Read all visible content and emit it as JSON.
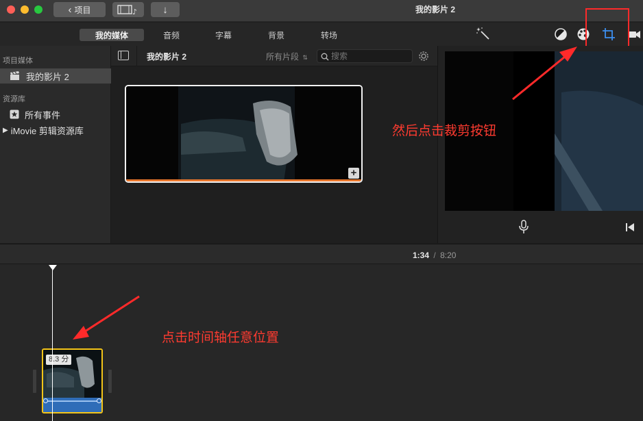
{
  "titlebar": {
    "back_label": "项目",
    "window_title": "我的影片 2"
  },
  "media_tabs": [
    {
      "label": "我的媒体",
      "active": true
    },
    {
      "label": "音频",
      "active": false
    },
    {
      "label": "字幕",
      "active": false
    },
    {
      "label": "背景",
      "active": false
    },
    {
      "label": "转场",
      "active": false
    }
  ],
  "sidebar": {
    "section_project_media": "项目媒体",
    "project_item": "我的影片 2",
    "section_library": "资源库",
    "all_events": "所有事件",
    "library_item": "iMovie 剪辑资源库"
  },
  "browser": {
    "title": "我的影片 2",
    "filter_label": "所有片段",
    "search_placeholder": "搜索"
  },
  "timeline": {
    "current_time": "1:34",
    "separator": "/",
    "total_time": "8:20",
    "clip_duration": "8.3 分"
  },
  "annotations": {
    "crop_hint": "然后点击裁剪按钮",
    "timeline_hint": "点击时间轴任意位置",
    "color": "#ff3b30"
  },
  "colors": {
    "accent_orange": "#e8762c",
    "selection_yellow": "#f5c518",
    "audio_blue": "#2f6db8"
  }
}
